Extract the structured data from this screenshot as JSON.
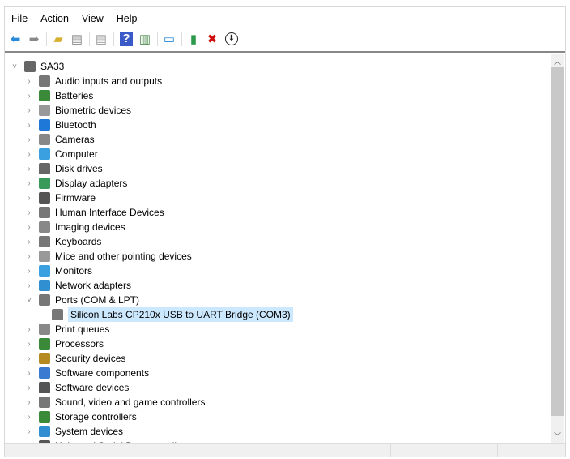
{
  "menu": [
    "File",
    "Action",
    "View",
    "Help"
  ],
  "toolbar": [
    "back-icon",
    "forward-icon",
    "up-folder-icon",
    "show-hide-console-tree-icon",
    "properties-icon",
    "help-icon",
    "action-pane-icon",
    "scan-hardware-icon",
    "update-driver-icon",
    "uninstall-icon",
    "disable-device-icon"
  ],
  "tree": {
    "root": "SA33",
    "items": [
      {
        "label": "Audio inputs and outputs",
        "icon": "speaker-icon",
        "color": "#777"
      },
      {
        "label": "Batteries",
        "icon": "battery-icon",
        "color": "#3a8a3a"
      },
      {
        "label": "Biometric devices",
        "icon": "fingerprint-icon",
        "color": "#999"
      },
      {
        "label": "Bluetooth",
        "icon": "bluetooth-icon",
        "color": "#1e78d7"
      },
      {
        "label": "Cameras",
        "icon": "camera-icon",
        "color": "#888"
      },
      {
        "label": "Computer",
        "icon": "computer-icon",
        "color": "#3aa0e0"
      },
      {
        "label": "Disk drives",
        "icon": "disk-icon",
        "color": "#666"
      },
      {
        "label": "Display adapters",
        "icon": "display-adapter-icon",
        "color": "#3a9a5a"
      },
      {
        "label": "Firmware",
        "icon": "firmware-icon",
        "color": "#555"
      },
      {
        "label": "Human Interface Devices",
        "icon": "hid-icon",
        "color": "#777"
      },
      {
        "label": "Imaging devices",
        "icon": "imaging-icon",
        "color": "#888"
      },
      {
        "label": "Keyboards",
        "icon": "keyboard-icon",
        "color": "#777"
      },
      {
        "label": "Mice and other pointing devices",
        "icon": "mouse-icon",
        "color": "#999"
      },
      {
        "label": "Monitors",
        "icon": "monitor-icon",
        "color": "#3aa0e0"
      },
      {
        "label": "Network adapters",
        "icon": "network-icon",
        "color": "#2f8fd0"
      },
      {
        "label": "Ports (COM & LPT)",
        "icon": "port-icon",
        "color": "#777",
        "expanded": true,
        "children": [
          {
            "label": "Silicon Labs CP210x USB to UART Bridge (COM3)",
            "icon": "port-icon",
            "color": "#777"
          }
        ]
      },
      {
        "label": "Print queues",
        "icon": "printer-icon",
        "color": "#888"
      },
      {
        "label": "Processors",
        "icon": "processor-icon",
        "color": "#3a8a3a"
      },
      {
        "label": "Security devices",
        "icon": "security-icon",
        "color": "#b58a20"
      },
      {
        "label": "Software components",
        "icon": "software-component-icon",
        "color": "#3a7ad0"
      },
      {
        "label": "Software devices",
        "icon": "software-device-icon",
        "color": "#555"
      },
      {
        "label": "Sound, video and game controllers",
        "icon": "speaker-icon",
        "color": "#777"
      },
      {
        "label": "Storage controllers",
        "icon": "storage-icon",
        "color": "#3a8a3a"
      },
      {
        "label": "System devices",
        "icon": "system-icon",
        "color": "#2f8fd0"
      },
      {
        "label": "Universal Serial Bus controllers",
        "icon": "usb-icon",
        "color": "#555"
      }
    ]
  }
}
